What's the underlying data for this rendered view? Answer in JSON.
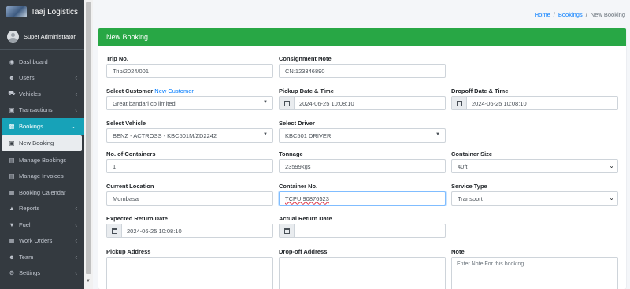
{
  "brand": {
    "name": "Taaj Logistics"
  },
  "user": {
    "name": "Super Administrator"
  },
  "sidebar": {
    "items": [
      {
        "label": "Dashboard",
        "icon": "dashboard-icon",
        "chevron": false
      },
      {
        "label": "Users",
        "icon": "users-icon",
        "chevron": true
      },
      {
        "label": "Vehicles",
        "icon": "car-icon",
        "chevron": true
      },
      {
        "label": "Transactions",
        "icon": "money-icon",
        "chevron": true
      },
      {
        "label": "Bookings",
        "icon": "bookings-icon",
        "chevron": true,
        "active": true
      },
      {
        "label": "New Booking",
        "icon": "new-booking-icon",
        "chevron": false,
        "sub_active": true
      },
      {
        "label": "Manage Bookings",
        "icon": "manage-bookings-icon",
        "chevron": false
      },
      {
        "label": "Manage Invoices",
        "icon": "invoices-icon",
        "chevron": false
      },
      {
        "label": "Booking Calendar",
        "icon": "calendar-icon",
        "chevron": false
      },
      {
        "label": "Reports",
        "icon": "reports-icon",
        "chevron": true
      },
      {
        "label": "Fuel",
        "icon": "fuel-icon",
        "chevron": true
      },
      {
        "label": "Work Orders",
        "icon": "cart-icon",
        "chevron": true
      },
      {
        "label": "Team",
        "icon": "team-icon",
        "chevron": true
      },
      {
        "label": "Settings",
        "icon": "gear-icon",
        "chevron": true
      }
    ]
  },
  "breadcrumb": {
    "home": "Home",
    "section": "Bookings",
    "current": "New Booking",
    "separator": "/"
  },
  "form": {
    "title": "New Booking",
    "trip_no": {
      "label": "Trip No.",
      "value": "Trip/2024/001"
    },
    "consignment_note": {
      "label": "Consignment Note",
      "value": "CN:123346890"
    },
    "customer": {
      "label": "Select Customer",
      "link": "New Customer",
      "value": "Great bandari co limited"
    },
    "pickup_datetime": {
      "label": "Pickup Date & Time",
      "value": "2024-06-25 10:08:10"
    },
    "dropoff_datetime": {
      "label": "Dropoff Date & Time",
      "value": "2024-06-25 10:08:10"
    },
    "vehicle": {
      "label": "Select Vehicle",
      "value": "BENZ - ACTROSS - KBC501M/ZD2242"
    },
    "driver": {
      "label": "Select Driver",
      "value": "KBC501 DRIVER"
    },
    "containers": {
      "label": "No. of Containers",
      "value": "1"
    },
    "tonnage": {
      "label": "Tonnage",
      "value": "23599kgs"
    },
    "container_size": {
      "label": "Container Size",
      "value": "40ft"
    },
    "current_location": {
      "label": "Current Location",
      "value": "Mombasa"
    },
    "container_no": {
      "label": "Container No.",
      "value": "TCPU 90876523"
    },
    "service_type": {
      "label": "Service Type",
      "value": "Transport"
    },
    "expected_return": {
      "label": "Expected Return Date",
      "value": "2024-06-25 10:08:10"
    },
    "actual_return": {
      "label": "Actual Return Date",
      "value": ""
    },
    "pickup_address": {
      "label": "Pickup Address",
      "value": ""
    },
    "dropoff_address": {
      "label": "Drop-off Address",
      "value": ""
    },
    "note": {
      "label": "Note",
      "placeholder": "Enter Note For this booking"
    }
  }
}
